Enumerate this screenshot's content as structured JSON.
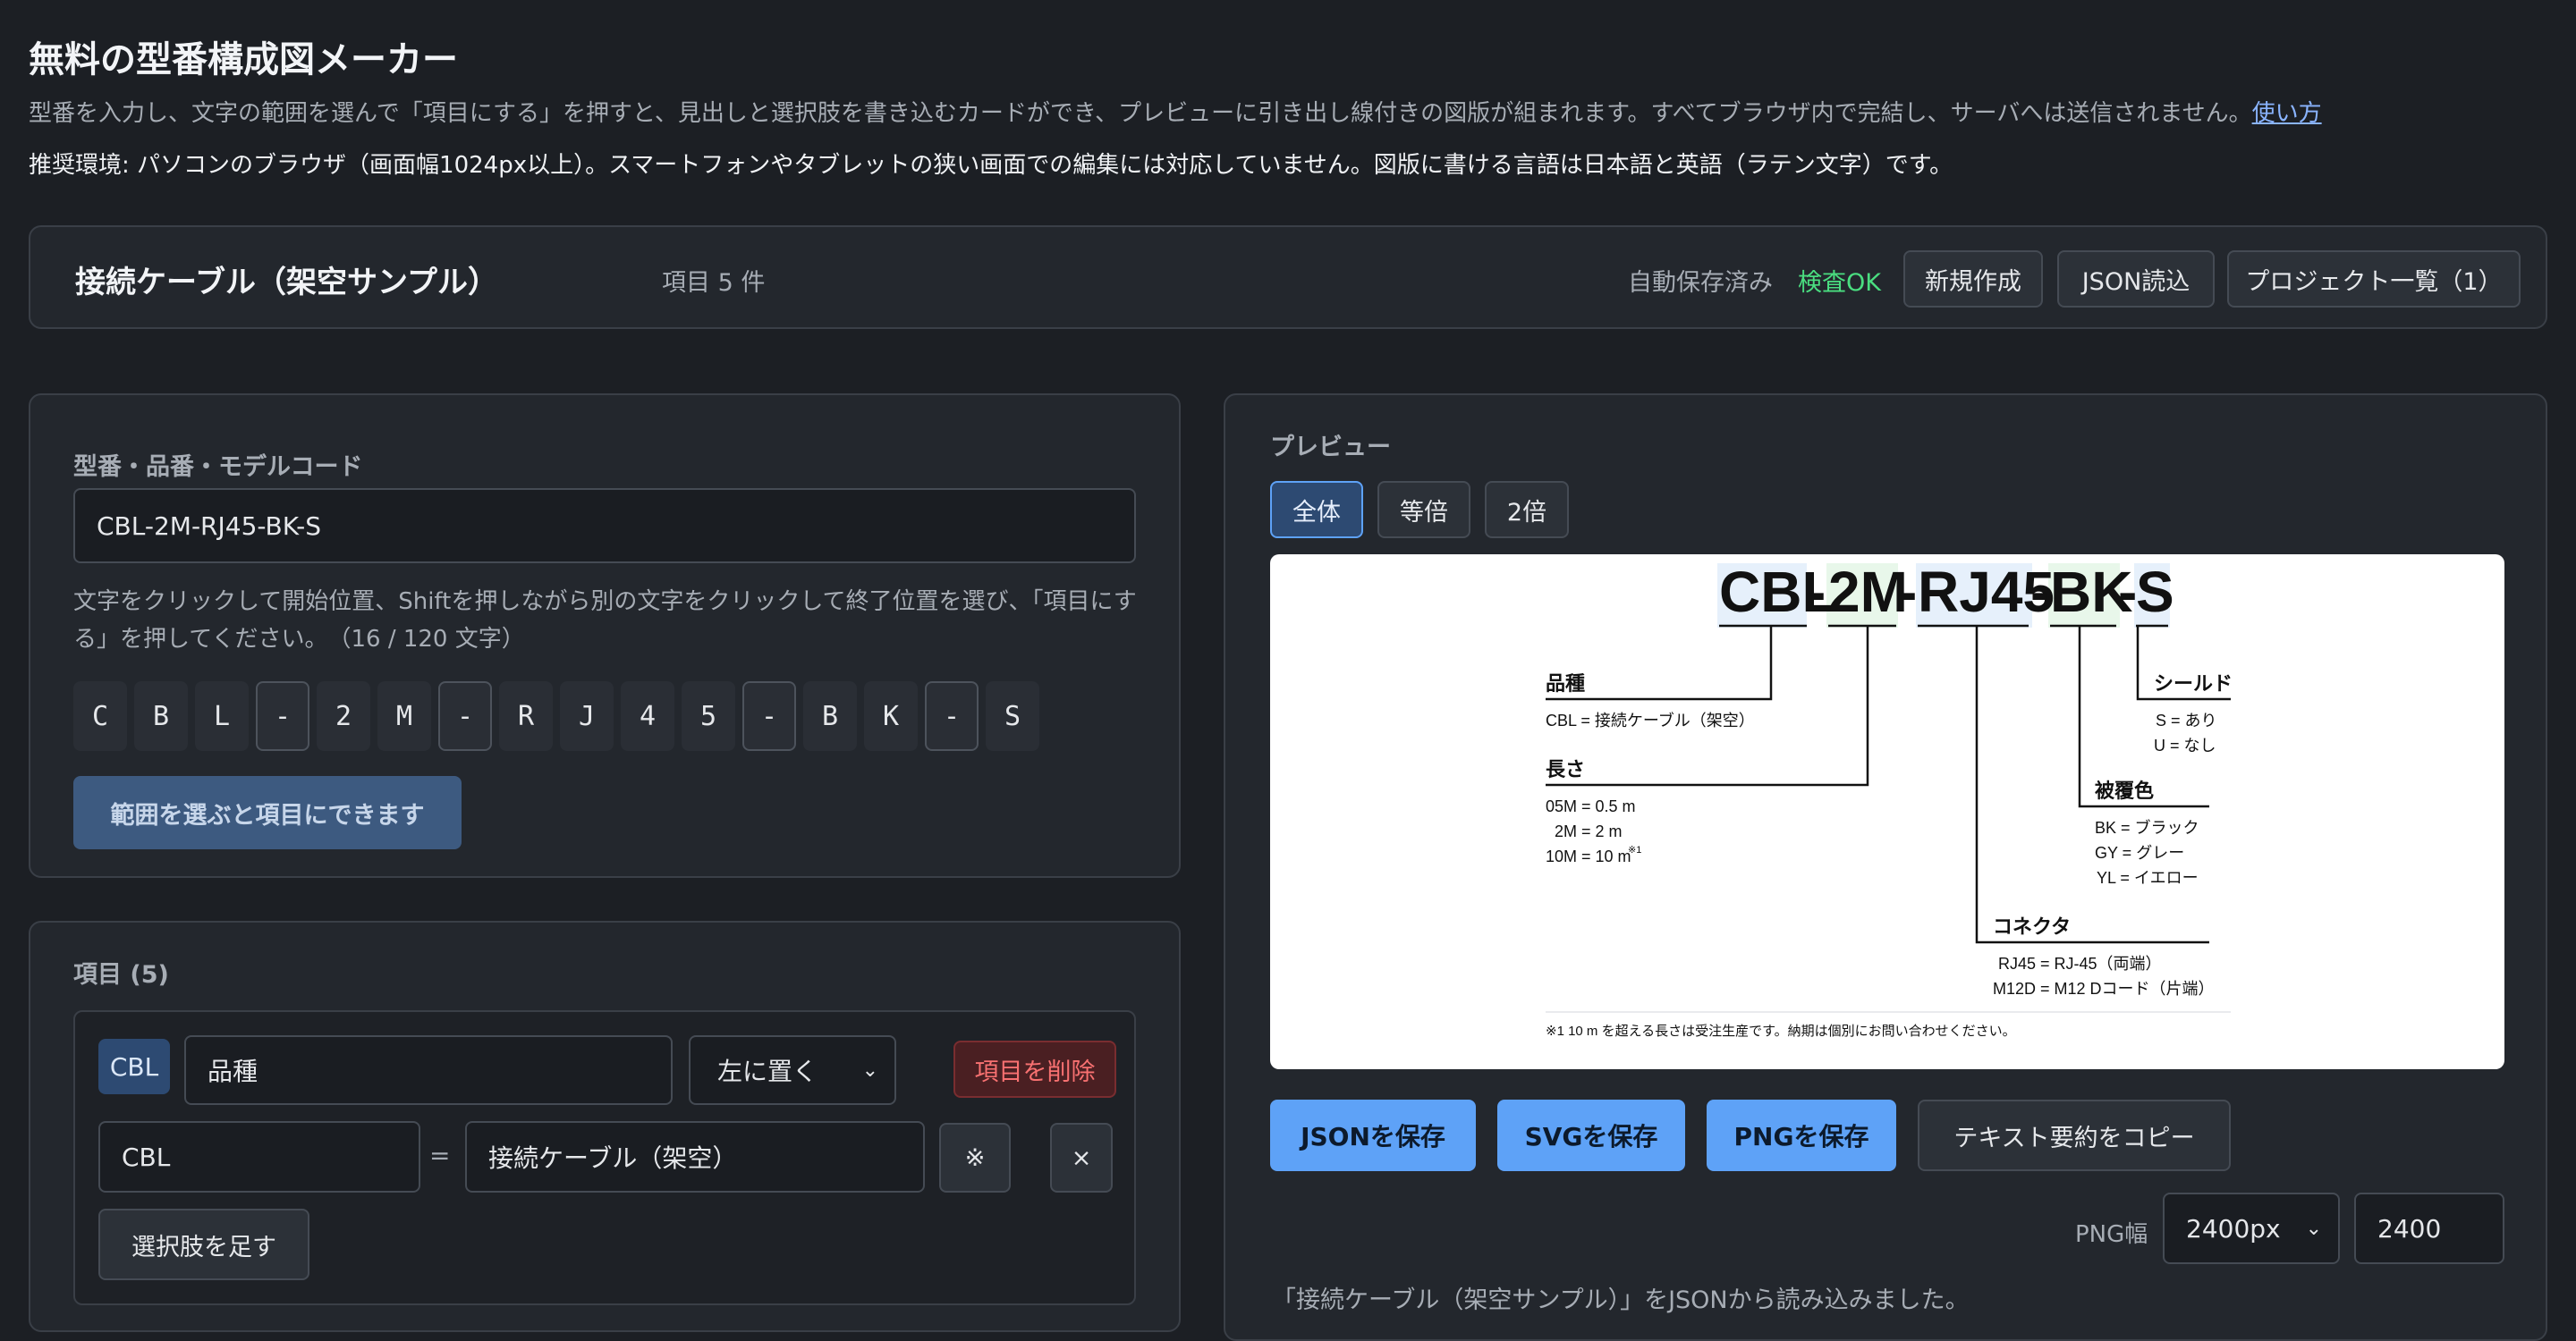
{
  "header": {
    "title": "無料の型番構成図メーカー",
    "description": "型番を入力し、文字の範囲を選んで「項目にする」を押すと、見出しと選択肢を書き込むカードができ、プレビューに引き出し線付きの図版が組まれます。すべてブラウザ内で完結し、サーバへは送信されません。",
    "help_link": "使い方",
    "environment": "推奨環境: パソコンのブラウザ（画面幅1024px以上）。スマートフォンやタブレットの狭い画面での編集には対応していません。図版に書ける言語は日本語と英語（ラテン文字）です。"
  },
  "topbar": {
    "project_title": "接続ケーブル（架空サンプル）",
    "item_count": "項目 5 件",
    "autosave": "自動保存済み",
    "check_status": "検査OK",
    "new_button": "新規作成",
    "json_load_button": "JSON読込",
    "project_list_button": "プロジェクト一覧（1）"
  },
  "model_panel": {
    "label": "型番・品番・モデルコード",
    "value": "CBL-2M-RJ45-BK-S",
    "help": "文字をクリックして開始位置、Shiftを押しながら別の文字をクリックして終了位置を選び、「項目にする」を押してください。",
    "char_count": "（16 / 120 文字）",
    "chars": [
      "C",
      "B",
      "L",
      "-",
      "2",
      "M",
      "-",
      "R",
      "J",
      "4",
      "5",
      "-",
      "B",
      "K",
      "-",
      "S"
    ],
    "range_button": "範囲を選ぶと項目にできます"
  },
  "items_panel": {
    "label": "項目 (5)",
    "card": {
      "tag": "CBL",
      "heading": "品種",
      "placement": "左に置く",
      "delete_button": "項目を削除",
      "option_code": "CBL",
      "equals": "=",
      "option_value": "接続ケーブル（架空）",
      "note_button": "※",
      "remove_button": "×",
      "add_option_button": "選択肢を足す"
    }
  },
  "preview": {
    "label": "プレビュー",
    "zoom_tabs": [
      "全体",
      "等倍",
      "2倍"
    ],
    "active_tab": "全体",
    "diagram": {
      "model_parts": [
        "CBL",
        "-",
        "2M",
        "-",
        "RJ45",
        "-",
        "BK",
        "-",
        "S"
      ],
      "groups": {
        "kind": {
          "title": "品種",
          "lines": [
            "CBL = 接続ケーブル（架空）"
          ]
        },
        "length": {
          "title": "長さ",
          "lines": [
            "05M = 0.5 m",
            "2M = 2 m",
            "10M = 10 m"
          ],
          "note_mark": "※1"
        },
        "connector": {
          "title": "コネクタ",
          "lines": [
            "RJ45 = RJ-45（両端）",
            "M12D = M12 Dコード（片端）"
          ]
        },
        "color": {
          "title": "被覆色",
          "lines": [
            "BK = ブラック",
            "GY = グレー",
            "YL = イエロー"
          ]
        },
        "shield": {
          "title": "シールド",
          "lines": [
            "S = あり",
            "U = なし"
          ]
        }
      },
      "footnote": "※1 10 m を超える長さは受注生産です。納期は個別にお問い合わせください。"
    },
    "save_json": "JSONを保存",
    "save_svg": "SVGを保存",
    "save_png": "PNGを保存",
    "copy_text": "テキスト要約をコピー",
    "png_width_label": "PNG幅",
    "png_width_select": "2400px",
    "png_width_value": "2400",
    "status_message": "「接続ケーブル（架空サンプル）」をJSONから読み込みました。"
  },
  "colors": {
    "accent": "#5ea2f7",
    "ok": "#4ade80",
    "danger": "#f87171",
    "background": "#1c1f24"
  }
}
